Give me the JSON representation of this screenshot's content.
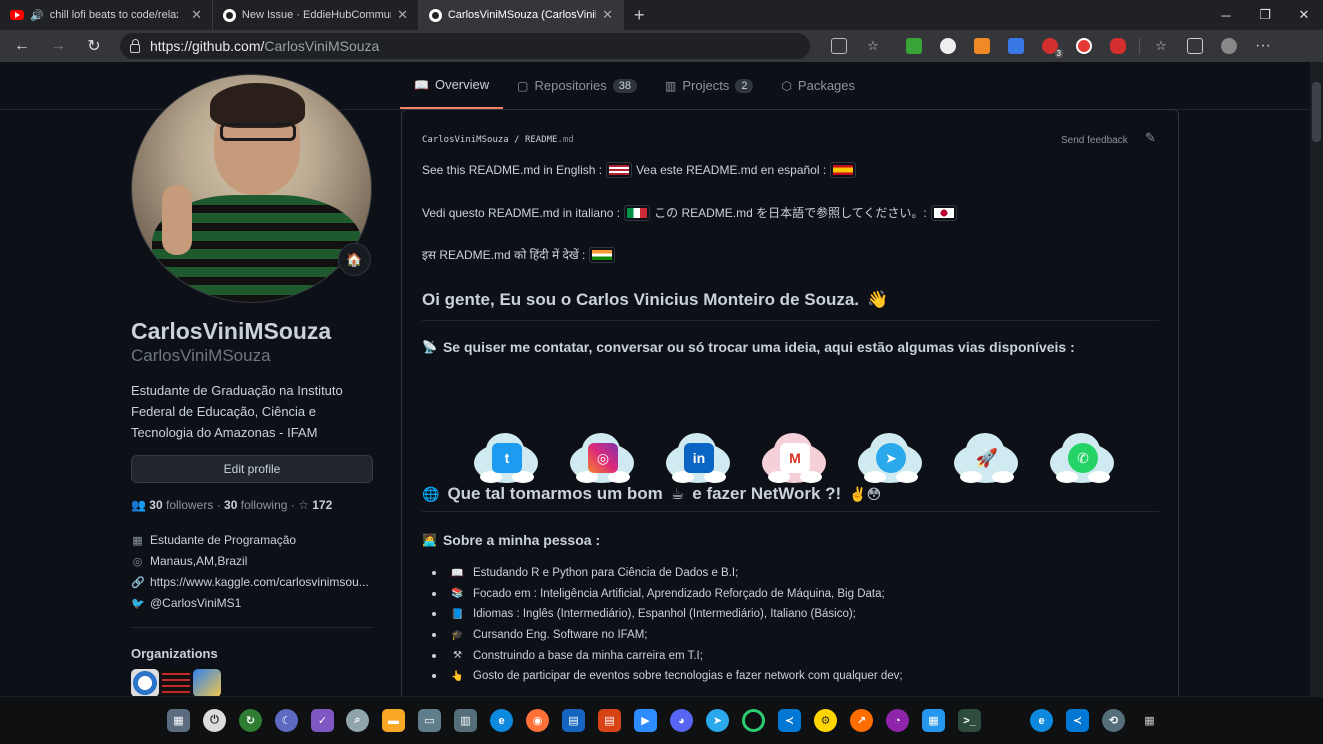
{
  "browser": {
    "tabs": [
      {
        "title": "chill lofi beats to code/relax",
        "icon": "youtube-icon",
        "active": false
      },
      {
        "title": "New Issue · EddieHubCommunit",
        "icon": "github-icon",
        "active": false
      },
      {
        "title": "CarlosViniMSouza (CarlosViniMS",
        "icon": "github-icon",
        "active": true
      }
    ],
    "new_tab": "+",
    "url_host": "https://github.com/",
    "url_path": "CarlosViniMSouza",
    "extension_badge": "3"
  },
  "profile": {
    "status_emoji": "🏠",
    "fullname": "CarlosViniMSouza",
    "login": "CarlosViniMSouza",
    "bio": "Estudante de Graduação na Instituto Federal de Educação, Ciência e Tecnologia do Amazonas - IFAM",
    "edit_button": "Edit profile",
    "followers": "30",
    "followers_label": "followers",
    "following": "30",
    "following_label": "following",
    "stars": "172",
    "company": "Estudante de Programação",
    "location": "Manaus,AM,Brazil",
    "website": "https://www.kaggle.com/carlosvinimsou...",
    "twitter": "@CarlosViniMS1",
    "organizations_title": "Organizations"
  },
  "nav_tabs": [
    {
      "label": "Overview",
      "count": null,
      "icon": "book-icon"
    },
    {
      "label": "Repositories",
      "count": "38",
      "icon": "repo-icon"
    },
    {
      "label": "Projects",
      "count": "2",
      "icon": "project-icon"
    },
    {
      "label": "Packages",
      "count": null,
      "icon": "package-icon"
    }
  ],
  "readme": {
    "path_user": "CarlosViniMSouza",
    "path_sep": "/",
    "path_file": "README",
    "path_ext": ".md",
    "feedback": "Send feedback",
    "line_en": "See this README.md in English :",
    "line_es": "Vea este README.md en español :",
    "line_it": "Vedi questo README.md in italiano :",
    "line_ja": "この README.md を日本語で参照してください。:",
    "line_hi": "इस README.md को हिंदी में देखें :",
    "heading": "Oi gente, Eu sou o Carlos Vinicius Monteiro de Souza.",
    "contact": "Se quiser me contatar, conversar ou só trocar uma ideia, aqui estão algumas vias disponíveis :",
    "network_a": "Que tal tomarmos um bom",
    "network_b": "e fazer NetWork ?!",
    "about_title": "Sobre a minha pessoa :",
    "about_items": [
      "Estudando R e Python para Ciência de Dados e B.I;",
      "Focado em : Inteligência Artificial, Aprendizado Reforçado de Máquina, Big Data;",
      "Idiomas : Inglês (Intermediário), Espanhol (Intermediário), Italiano (Básico);",
      "Cursando Eng. Software no IFAM;",
      "Construindo a base da minha carreira em T.I;",
      "Gosto de participar de eventos sobre tecnologias e fazer network com qualquer dev;"
    ]
  },
  "colors": {
    "bg": "#0d1117",
    "accent_tab": "#f78166",
    "text": "#c9d1d9",
    "muted": "#8b949e"
  }
}
